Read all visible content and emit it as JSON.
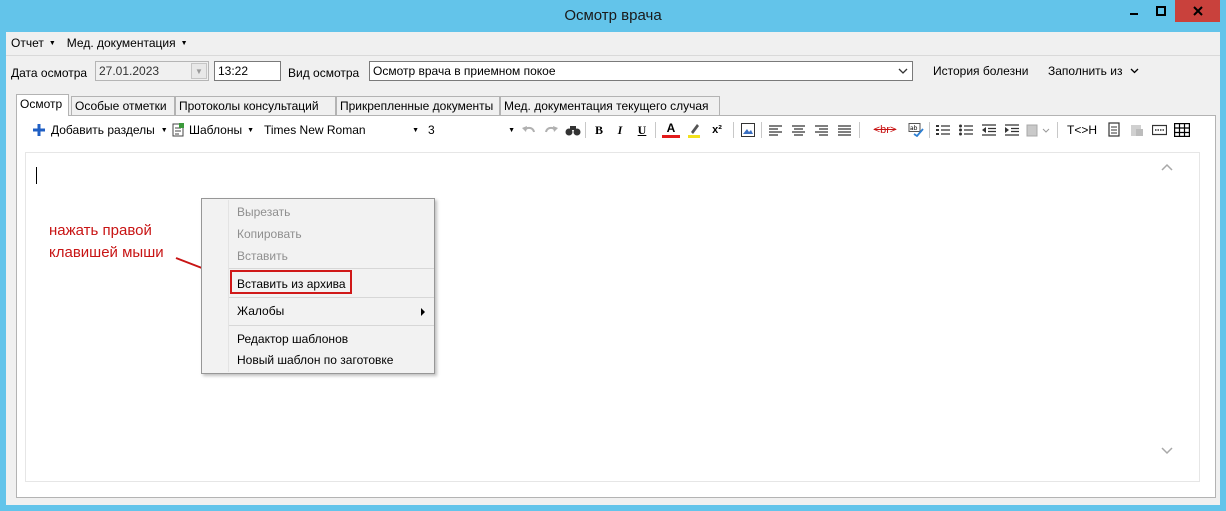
{
  "window": {
    "title": "Осмотр врача",
    "colors": {
      "titlebar": "#63c4ea",
      "close": "#c9413c",
      "annotation": "#c81414"
    }
  },
  "menubar": {
    "items": [
      {
        "label": "Отчет",
        "icon": "caret-down-icon"
      },
      {
        "label": "Мед. документация",
        "icon": "caret-down-icon"
      }
    ]
  },
  "visit": {
    "date_label": "Дата осмотра",
    "date_value": "27.01.2023",
    "time_value": "13:22",
    "type_label": "Вид осмотра",
    "type_value": "Осмотр врача в приемном покое",
    "history_button": "История болезни",
    "fill_from_button": "Заполнить из"
  },
  "tabs": [
    {
      "label": "Осмотр",
      "active": true
    },
    {
      "label": "Особые отметки",
      "active": false
    },
    {
      "label": "Протоколы консультаций",
      "active": false
    },
    {
      "label": "Прикрепленные документы",
      "active": false
    },
    {
      "label": "Мед. документация текущего случая",
      "active": false
    }
  ],
  "toolbar": {
    "add_sections": "Добавить разделы",
    "templates": "Шаблоны",
    "font_name": "Times New Roman",
    "font_size": "3",
    "bold": "B",
    "italic": "I",
    "underline": "U",
    "font_color": "A",
    "superscript": "x²",
    "br_tag": "<br>",
    "swap_tags": "T<>H",
    "icons": [
      "plus-icon",
      "template-icon",
      "undo-icon",
      "redo-icon",
      "find-icon",
      "highlight-icon",
      "image-icon",
      "align-left-icon",
      "align-center-icon",
      "align-right-icon",
      "align-justify-icon",
      "spellcheck-icon",
      "numbered-list-icon",
      "bullet-list-icon",
      "outdent-icon",
      "indent-icon",
      "paste-icon",
      "copy-doc-icon",
      "field-icon",
      "table-icon"
    ]
  },
  "annotation": {
    "line1": "нажать правой",
    "line2": "клавишей мыши"
  },
  "context_menu": {
    "cut": "Вырезать",
    "copy": "Копировать",
    "paste": "Вставить",
    "paste_archive": "Вставить из архива",
    "complaints": "Жалобы",
    "template_editor": "Редактор шаблонов",
    "new_template": "Новый шаблон по заготовке"
  }
}
